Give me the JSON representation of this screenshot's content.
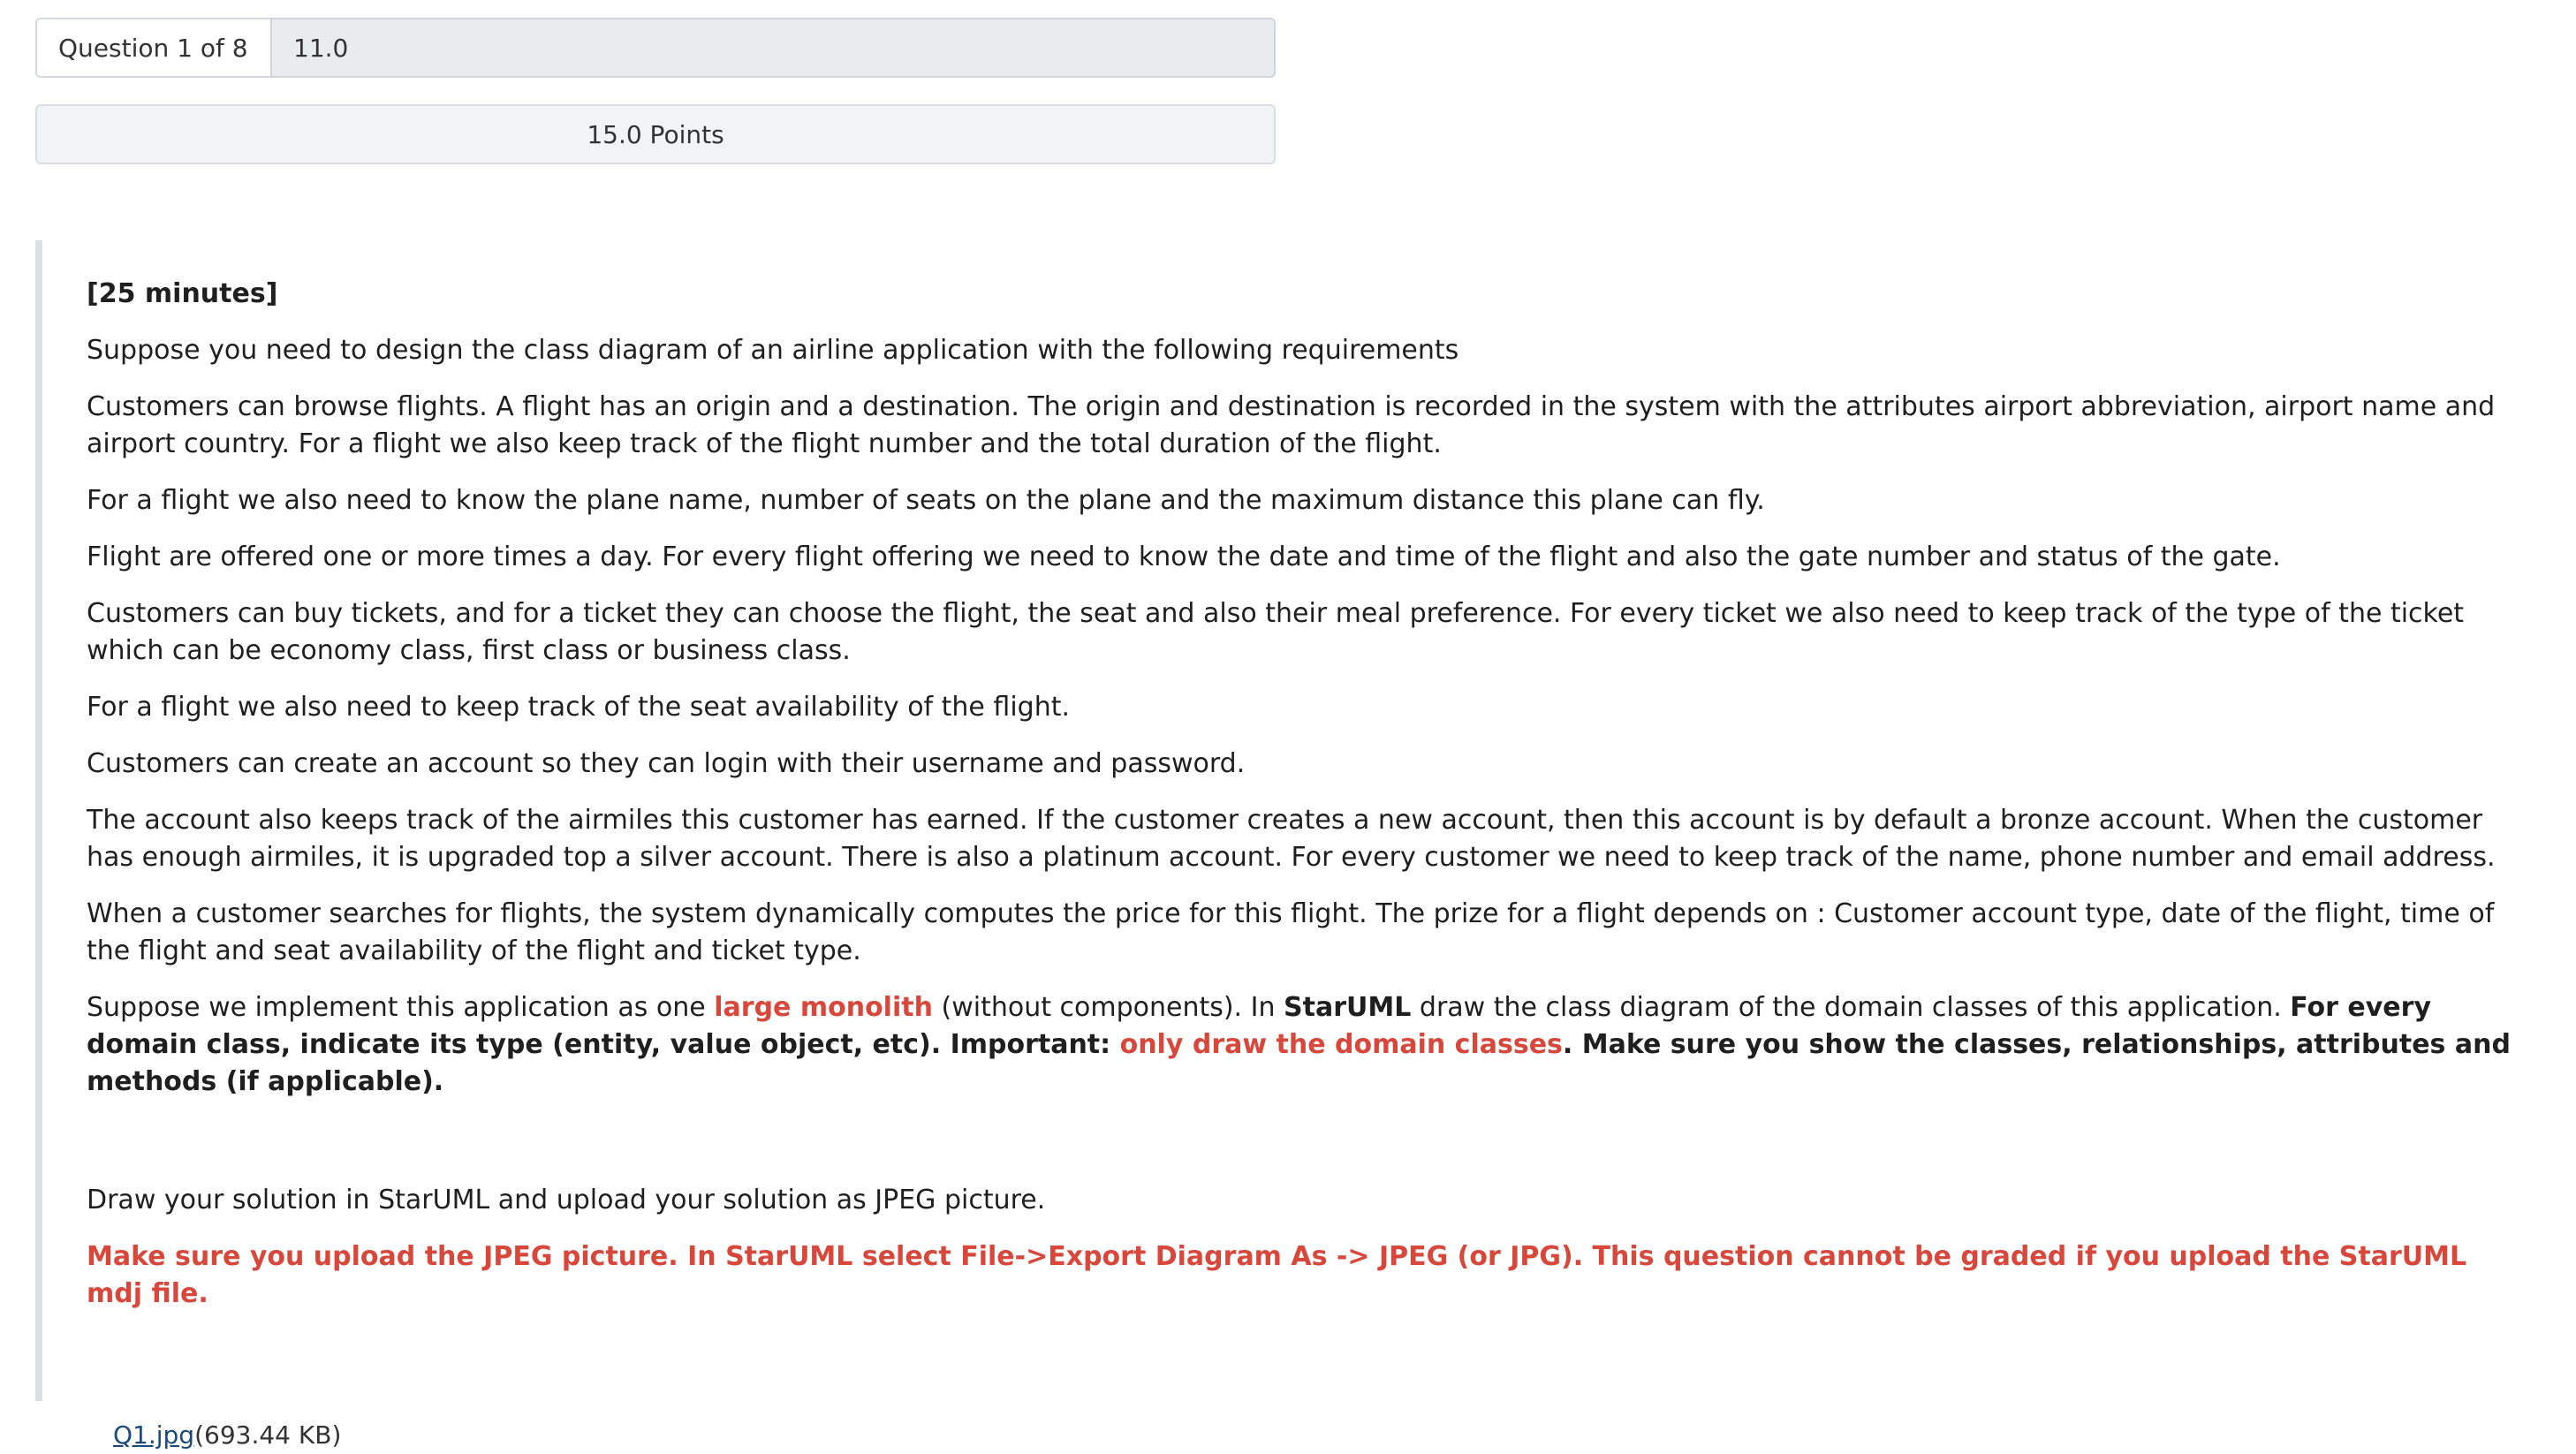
{
  "header": {
    "question_label": "Question 1 of 8",
    "score_value": "11.0",
    "points": "15.0 Points"
  },
  "question": {
    "time": "[25 minutes]",
    "p1": "Suppose you need to design the class diagram of an airline application with the following requirements",
    "p2": "Customers can browse flights. A flight has an origin and a destination. The origin and destination is recorded in the system with the attributes airport abbreviation, airport name and airport country. For a flight we also keep track of the flight number and the total duration of the flight.",
    "p3": "For a flight we also need to know the plane name, number of seats on the plane and the maximum distance this plane can fly.",
    "p4": "Flight are offered one or more times a day. For every flight offering we need to know the date and time of the flight and also the gate number and status of the gate.",
    "p5": "Customers can buy tickets, and for a ticket they can choose the flight, the seat and also their meal preference. For every ticket we also need to keep track of the type of the ticket which can be economy class, first class or business class.",
    "p6": "For a flight we also need to keep track of the seat availability of the flight.",
    "p7": "Customers can create an account so they can login with their username and password.",
    "p8": "The account also keeps track of the airmiles this customer has earned. If the customer creates a new account, then this account is by default a bronze account. When the customer has enough airmiles, it is upgraded top a silver account. There is also a platinum account. For every customer we need to keep track of the name, phone number and email address.",
    "p9": "When a customer searches for flights, the system dynamically computes the price for this flight. The prize for a flight depends on : Customer account type, date of the flight, time of the flight and seat availability of the flight and ticket type.",
    "p10": {
      "s1": "Suppose we implement this application as one ",
      "s2": "large monolith",
      "s3": " (without components). In ",
      "s4": "StarUML",
      "s5": " draw the class diagram of the domain classes of this application. ",
      "s6": "For every domain class, indicate its type (entity, value object, etc). Important: ",
      "s7": "only draw the domain classes",
      "s8": ". Make sure you show the classes, relationships, attributes and methods (if applicable)."
    },
    "p11": "Draw your solution in StarUML and upload your solution as JPEG picture.",
    "p12": "Make sure you upload the JPEG picture. In StarUML select File->Export Diagram As -> JPEG (or JPG). This question cannot be graded if you upload the StarUML mdj file."
  },
  "attachment": {
    "file_name": "Q1.jpg",
    "file_size": "(693.44 KB)"
  }
}
